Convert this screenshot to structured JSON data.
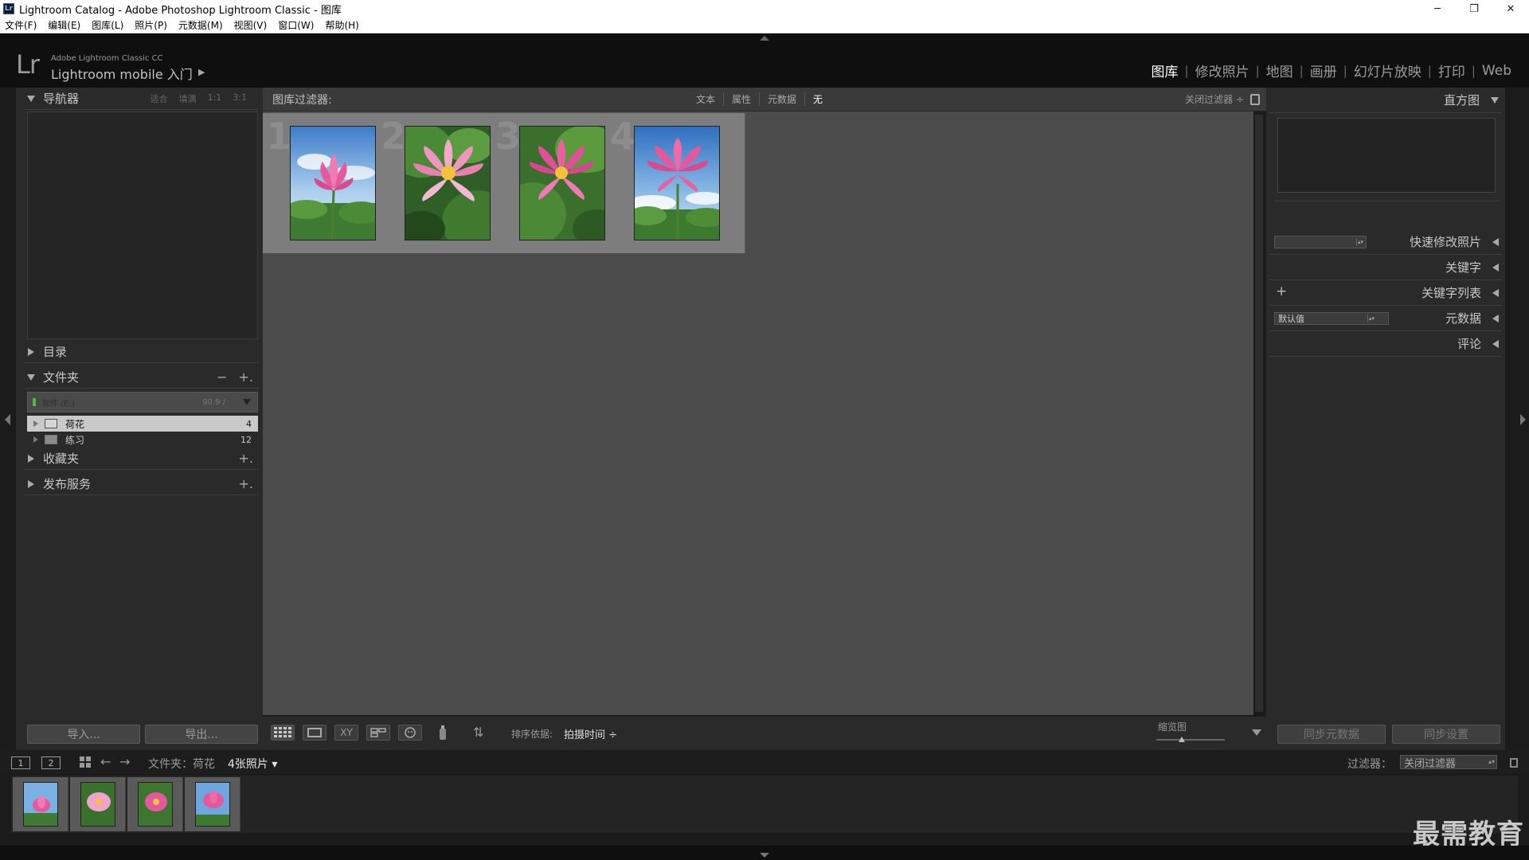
{
  "titlebar": {
    "icon_text": "Lr",
    "title": "Lightroom Catalog - Adobe Photoshop Lightroom Classic - 图库",
    "minimize": "─",
    "restore": "❐",
    "close": "✕"
  },
  "menu": {
    "items": [
      "文件(F)",
      "编辑(E)",
      "图库(L)",
      "照片(P)",
      "元数据(M)",
      "视图(V)",
      "窗口(W)",
      "帮助(H)"
    ]
  },
  "identity": {
    "logo": "Lr",
    "product_small": "Adobe Lightroom Classic CC",
    "product_big": "Lightroom mobile 入门",
    "play": "▶"
  },
  "modules": {
    "items": [
      "图库",
      "修改照片",
      "地图",
      "画册",
      "幻灯片放映",
      "打印",
      "Web"
    ],
    "active": "图库",
    "separator": "|"
  },
  "left_panel": {
    "navigator": {
      "title": "导航器",
      "zooms": [
        "适合",
        "填满",
        "1:1",
        "3:1"
      ]
    },
    "catalog": {
      "title": "目录"
    },
    "folders": {
      "title": "文件夹",
      "minus": "−",
      "plus": "+.",
      "volume": {
        "name": "软件 (E:)",
        "stats": "90.9 /"
      },
      "items": [
        {
          "name": "荷花",
          "count": "4",
          "selected": true
        },
        {
          "name": "练习",
          "count": "12",
          "selected": false
        }
      ]
    },
    "collections": {
      "title": "收藏夹",
      "plus": "+."
    },
    "publish": {
      "title": "发布服务",
      "plus": "+."
    },
    "import_button": "导入...",
    "export_button": "导出..."
  },
  "filter_bar": {
    "title": "图库过滤器:",
    "options": [
      "文本",
      "属性",
      "元数据",
      "无"
    ],
    "active": "无",
    "preset": "关闭过滤器 ÷"
  },
  "grid": {
    "cells": [
      {
        "index": "1",
        "variant": "sky"
      },
      {
        "index": "2",
        "variant": "leaf"
      },
      {
        "index": "3",
        "variant": "leaf"
      },
      {
        "index": "4",
        "variant": "sky"
      }
    ]
  },
  "toolbar": {
    "icons": [
      "grid-view-icon",
      "loupe-view-icon",
      "compare-view-icon",
      "survey-view-icon",
      "people-view-icon",
      "spray-can-icon",
      "sort-direction-icon"
    ],
    "compare_text": "XY",
    "sort_arrows": "⇅",
    "sort_label": "排序依据:",
    "sort_value": "拍摄时间 ÷",
    "thumb_label": "缩览图"
  },
  "right_panel": {
    "histogram": {
      "title": "直方图"
    },
    "quick_develop": {
      "title": "快速修改照片"
    },
    "keywording": {
      "title": "关键字"
    },
    "keyword_list": {
      "title": "关键字列表",
      "plus": "+"
    },
    "metadata": {
      "title": "元数据",
      "preset": "默认值"
    },
    "comments": {
      "title": "评论"
    },
    "sync_metadata_button": "同步元数据",
    "sync_settings_button": "同步设置"
  },
  "filmstrip_bar": {
    "screen1": "1",
    "screen2": "2",
    "back": "←",
    "forward": "→",
    "path": "文件夹：荷花",
    "count": "4张照片 ▾",
    "filter_label": "过滤器：",
    "filter_value": "关闭过滤器"
  },
  "filmstrip": {
    "thumbs": [
      "sky",
      "leaf",
      "leaf",
      "sky"
    ]
  },
  "watermark": "最需教育",
  "colors": {
    "lotus_pink": "#e45a9a",
    "lotus_center": "#f2c23a",
    "sky": "#5b96d8",
    "leaf": "#3f7a32"
  }
}
